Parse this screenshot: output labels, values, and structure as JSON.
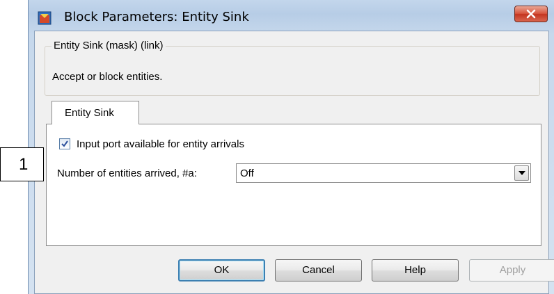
{
  "window": {
    "title": "Block Parameters: Entity Sink",
    "icon": "simulink-block-icon"
  },
  "group": {
    "legend": "Entity Sink (mask) (link)",
    "description": "Accept or block entities."
  },
  "tabs": [
    {
      "label": "Entity Sink",
      "selected": true
    }
  ],
  "options": {
    "input_port_label": "Input port available for entity arrivals",
    "input_port_checked": true,
    "arrived_label": "Number of entities arrived, #a:",
    "arrived_value": "Off"
  },
  "buttons": {
    "ok": "OK",
    "cancel": "Cancel",
    "help": "Help",
    "apply": "Apply"
  },
  "annotation": {
    "number": "1"
  },
  "colors": {
    "close_button": "#c3341f",
    "default_button_border": "#3c7fb1"
  }
}
